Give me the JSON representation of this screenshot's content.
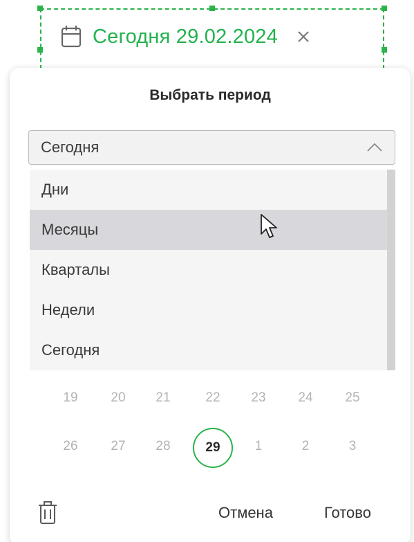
{
  "date_chip": {
    "text": "Сегодня 29.02.2024",
    "icon": "calendar-icon",
    "clear_icon": "close-icon",
    "accent_color": "#22b24c"
  },
  "panel": {
    "title": "Выбрать период",
    "select": {
      "value": "Сегодня",
      "icon": "chevron-up-icon",
      "expanded": true
    },
    "dropdown": {
      "items": [
        "Дни",
        "Месяцы",
        "Кварталы",
        "Недели",
        "Сегодня"
      ],
      "hovered_index": 1
    },
    "calendar": {
      "rows": [
        [
          "19",
          "20",
          "21",
          "22",
          "23",
          "24",
          "25"
        ],
        [
          "26",
          "27",
          "28",
          "29",
          "1",
          "2",
          "3"
        ]
      ],
      "selected_day": "29"
    },
    "footer": {
      "delete_icon": "trash-icon",
      "cancel_label": "Отмена",
      "done_label": "Готово"
    }
  }
}
